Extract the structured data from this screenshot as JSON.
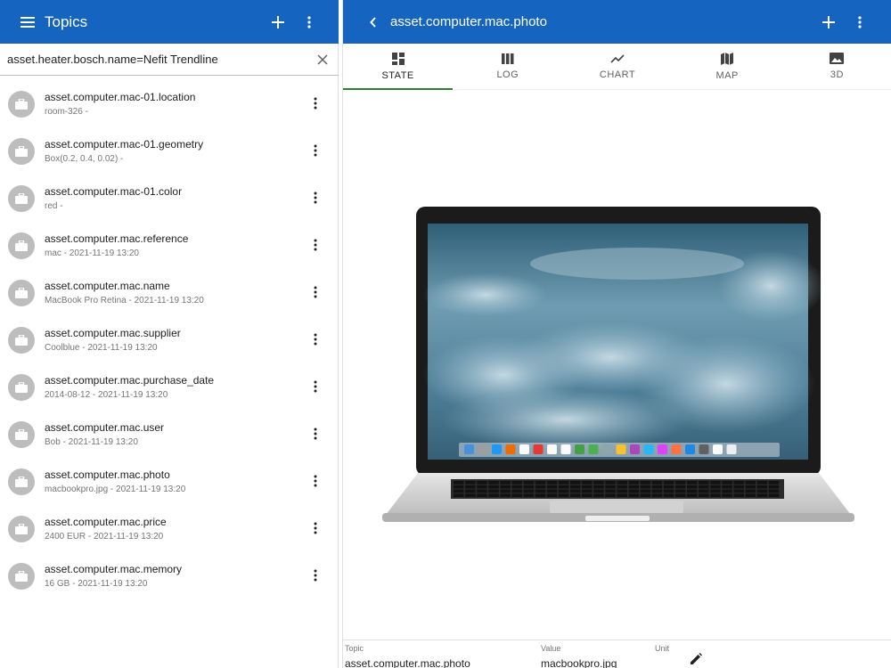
{
  "colors": {
    "appbar": "#1565c0",
    "tab_indicator": "#2e7d32",
    "avatar": "#bdbdbd"
  },
  "left": {
    "title": "Topics",
    "icons": {
      "menu": "menu-icon",
      "add": "plus-icon",
      "more": "more-vert-icon"
    },
    "search": {
      "value": "asset.heater.bosch.name=Nefit Trendline",
      "clear_icon": "close-icon"
    },
    "items": [
      {
        "title": "asset.computer.mac-01.location",
        "subtitle": "room-326 -"
      },
      {
        "title": "asset.computer.mac-01.geometry",
        "subtitle": "Box(0.2, 0.4, 0.02) -"
      },
      {
        "title": "asset.computer.mac-01.color",
        "subtitle": "red -"
      },
      {
        "title": "asset.computer.mac.reference",
        "subtitle": "mac - 2021-11-19 13:20"
      },
      {
        "title": "asset.computer.mac.name",
        "subtitle": "MacBook Pro Retina - 2021-11-19 13:20"
      },
      {
        "title": "asset.computer.mac.supplier",
        "subtitle": "Coolblue - 2021-11-19 13:20"
      },
      {
        "title": "asset.computer.mac.purchase_date",
        "subtitle": "2014-08-12 - 2021-11-19 13:20"
      },
      {
        "title": "asset.computer.mac.user",
        "subtitle": "Bob - 2021-11-19 13:20"
      },
      {
        "title": "asset.computer.mac.photo",
        "subtitle": "macbookpro.jpg - 2021-11-19 13:20"
      },
      {
        "title": "asset.computer.mac.price",
        "subtitle": "2400 EUR - 2021-11-19 13:20"
      },
      {
        "title": "asset.computer.mac.memory",
        "subtitle": "16 GB - 2021-11-19 13:20"
      }
    ]
  },
  "right": {
    "title": "asset.computer.mac.photo",
    "icons": {
      "back": "chevron-left-icon",
      "add": "plus-icon",
      "more": "more-vert-icon"
    },
    "tabs": [
      {
        "label": "STATE",
        "icon": "dashboard-icon",
        "active": true
      },
      {
        "label": "LOG",
        "icon": "columns-icon",
        "active": false
      },
      {
        "label": "CHART",
        "icon": "trending-icon",
        "active": false
      },
      {
        "label": "MAP",
        "icon": "map-icon",
        "active": false
      },
      {
        "label": "3D",
        "icon": "image-icon",
        "active": false
      }
    ],
    "photo": {
      "subject": "laptop-photo"
    },
    "footer": {
      "topic_label": "Topic",
      "topic_value": "asset.computer.mac.photo",
      "value_label": "Value",
      "value_value": "macbookpro.jpg",
      "unit_label": "Unit",
      "unit_value": "",
      "edit_icon": "pencil-icon"
    }
  }
}
